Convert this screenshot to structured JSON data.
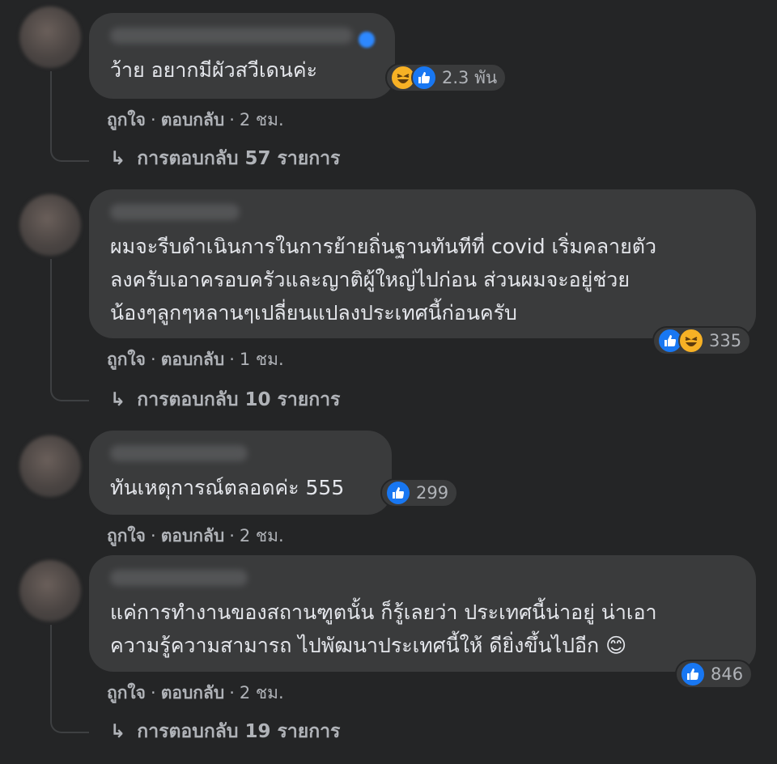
{
  "comments": [
    {
      "text_lines": [
        "ว้าย อยากมีผัวสวีเดนค่ะ"
      ],
      "reactions": [
        "haha",
        "like"
      ],
      "reaction_count": "2.3 พัน",
      "like_label": "ถูกใจ",
      "reply_label": "ตอบกลับ",
      "time": "2 ชม.",
      "view_replies": "การตอบกลับ 57 รายการ"
    },
    {
      "text_lines": [
        "ผมจะรีบดำเนินการในการย้ายถิ่นฐานทันทีที่ covid เริ่มคลายตัว",
        "ลงครับเอาครอบครัวและญาติผู้ใหญ่ไปก่อน ส่วนผมจะอยู่ช่วย",
        "น้องๆลูกๆหลานๆเปลี่ยนแปลงประเทศนี้ก่อนครับ"
      ],
      "reactions": [
        "like",
        "haha"
      ],
      "reaction_count": "335",
      "like_label": "ถูกใจ",
      "reply_label": "ตอบกลับ",
      "time": "1 ชม.",
      "view_replies": "การตอบกลับ 10 รายการ"
    },
    {
      "text_lines": [
        "ทันเหตุการณ์ตลอดค่ะ 555"
      ],
      "reactions": [
        "like"
      ],
      "reaction_count": "299",
      "like_label": "ถูกใจ",
      "reply_label": "ตอบกลับ",
      "time": "2 ชม."
    },
    {
      "text_lines": [
        "แค่การทำงานของสถานฑูตนั้น ก็รู้เลยว่า ประเทศนี้น่าอยู่ น่าเอา",
        "ความรู้ความสามารถ ไปพัฒนาประเทศนี้ให้ ดียิ่งขึ้นไปอีก 😊"
      ],
      "reactions": [
        "like"
      ],
      "reaction_count": "846",
      "like_label": "ถูกใจ",
      "reply_label": "ตอบกลับ",
      "time": "2 ชม.",
      "view_replies": "การตอบกลับ 19 รายการ"
    }
  ],
  "colors": {
    "background": "#242526",
    "bubble": "#3a3b3c",
    "like": "#1877f2",
    "haha": "#f7b125",
    "secondary_text": "#b0b3b8"
  },
  "icons": {
    "reply_arrow": "↳"
  }
}
